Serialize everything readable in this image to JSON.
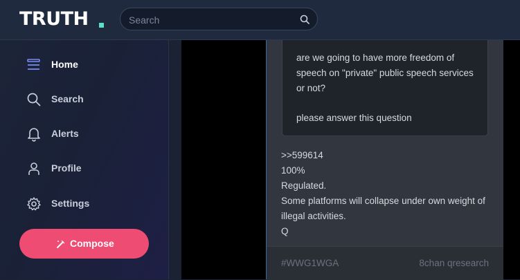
{
  "header": {
    "logo_text": "TRUTH",
    "logo_dot_color": "#5be0c8",
    "search_placeholder": "Search",
    "search_icon": "search-icon"
  },
  "sidebar": {
    "items": [
      {
        "label": "Home",
        "icon": "home-icon",
        "active": true
      },
      {
        "label": "Search",
        "icon": "search-icon",
        "active": false
      },
      {
        "label": "Alerts",
        "icon": "bell-icon",
        "active": false
      },
      {
        "label": "Profile",
        "icon": "user-icon",
        "active": false
      },
      {
        "label": "Settings",
        "icon": "gear-icon",
        "active": false
      }
    ],
    "compose_label": "Compose",
    "compose_icon": "pencil-icon",
    "compose_color": "#ef4c73"
  },
  "post": {
    "quote_lines": [
      "are we going to have more freedom of",
      "speech on \"private\" public speech services",
      "or not?",
      "please answer this question"
    ],
    "body_lines": [
      ">>599614",
      "100%",
      "Regulated.",
      "Some platforms will collapse under own weight of",
      "illegal activities.",
      "Q"
    ],
    "footer_tag": "#WWG1WGA",
    "footer_source": "8chan qresearch"
  }
}
